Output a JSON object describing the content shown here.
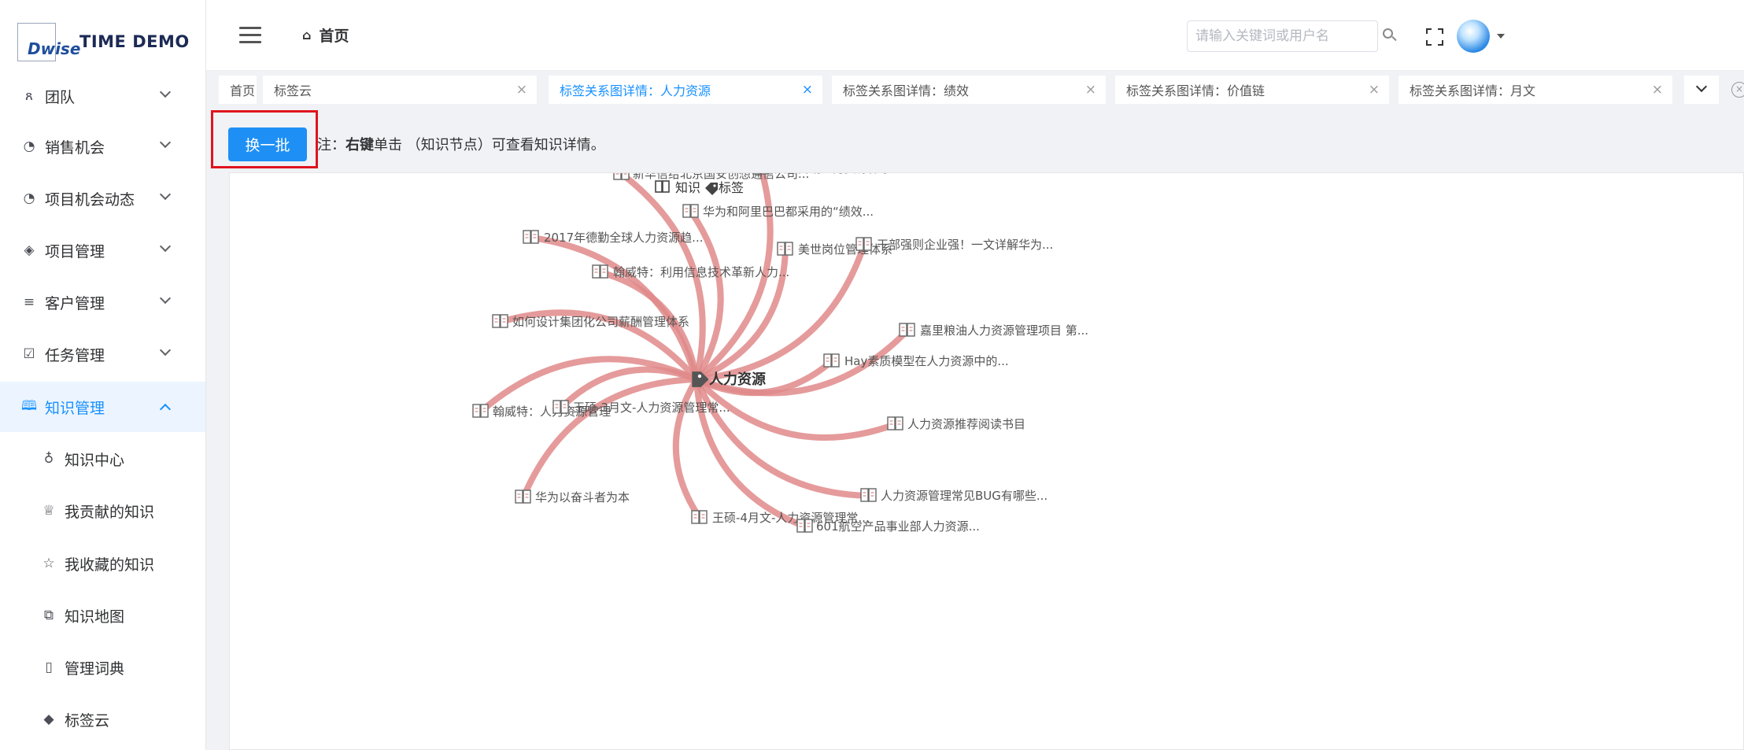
{
  "app": {
    "logo_text": "Dwise",
    "title": "TIME DEMO"
  },
  "sidebar": {
    "items": [
      {
        "label": "团队",
        "icon": "users-icon",
        "glyph": "ጸ",
        "active": false,
        "sub": false,
        "caret": true
      },
      {
        "label": "销售机会",
        "icon": "pie-chart-icon",
        "glyph": "◔",
        "active": false,
        "sub": false,
        "caret": true
      },
      {
        "label": "项目机会动态",
        "icon": "pie-chart-icon",
        "glyph": "◔",
        "active": false,
        "sub": false,
        "caret": true
      },
      {
        "label": "项目管理",
        "icon": "layers-icon",
        "glyph": "◈",
        "active": false,
        "sub": false,
        "caret": true
      },
      {
        "label": "客户管理",
        "icon": "list-icon",
        "glyph": "≡",
        "active": false,
        "sub": false,
        "caret": true
      },
      {
        "label": "任务管理",
        "icon": "calendar-check-icon",
        "glyph": "☑",
        "active": false,
        "sub": false,
        "caret": true
      },
      {
        "label": "知识管理",
        "icon": "book-icon",
        "glyph": "🕮",
        "active": true,
        "sub": false,
        "caret": true
      },
      {
        "label": "知识中心",
        "icon": "bulb-icon",
        "glyph": "♁",
        "active": false,
        "sub": true,
        "caret": false
      },
      {
        "label": "我贡献的知识",
        "icon": "trophy-icon",
        "glyph": "♕",
        "active": false,
        "sub": true,
        "caret": false
      },
      {
        "label": "我收藏的知识",
        "icon": "star-icon",
        "glyph": "☆",
        "active": false,
        "sub": true,
        "caret": false
      },
      {
        "label": "知识地图",
        "icon": "sitemap-icon",
        "glyph": "⧉",
        "active": false,
        "sub": true,
        "caret": false
      },
      {
        "label": "管理词典",
        "icon": "dictionary-icon",
        "glyph": "▯",
        "active": false,
        "sub": true,
        "caret": false
      },
      {
        "label": "标签云",
        "icon": "tag-icon",
        "glyph": "◆",
        "active": false,
        "sub": true,
        "caret": false
      }
    ]
  },
  "header": {
    "breadcrumb": "首页",
    "search_placeholder": "请输入关键词或用户名"
  },
  "tabs": [
    {
      "label": "首页",
      "closable": false,
      "active": false
    },
    {
      "label": "标签云",
      "closable": true,
      "active": false
    },
    {
      "label": "标签关系图详情：人力资源",
      "closable": true,
      "active": true
    },
    {
      "label": "标签关系图详情：绩效",
      "closable": true,
      "active": false
    },
    {
      "label": "标签关系图详情：价值链",
      "closable": true,
      "active": false
    },
    {
      "label": "标签关系图详情：月文",
      "closable": true,
      "active": false
    }
  ],
  "toolbar": {
    "refresh_label": "换一批",
    "note_prefix": "注：",
    "note_bold": "右键",
    "note_rest": "单击 （知识节点）可查看知识详情。"
  },
  "graph": {
    "legend": {
      "knowledge": "知识",
      "tag": "标签"
    },
    "center": "人力资源",
    "edge_color": "#e08a8a",
    "nodes": [
      "新华信给北京国安创想通信公司...",
      "华为营销人力资源体系",
      "华为和阿里巴巴都采用的“绩效...",
      "2017年德勤全球人力资源趋...",
      "翰威特：利用信息技术革新人力...",
      "美世岗位管理体系",
      "干部强则企业强！一文详解华为...",
      "如何设计集团化公司薪酬管理体系",
      "嘉里粮油人力资源管理项目 第...",
      "Hay素质模型在人力资源中的...",
      "翰威特：人力资源管理",
      "王硕-3月文-人力资源管理常...",
      "人力资源推荐阅读书目",
      "华为以奋斗者为本",
      "人力资源管理常见BUG有哪些...",
      "王硕-4月文-人力资源管理常...",
      "601航空产品事业部人力资源..."
    ]
  }
}
